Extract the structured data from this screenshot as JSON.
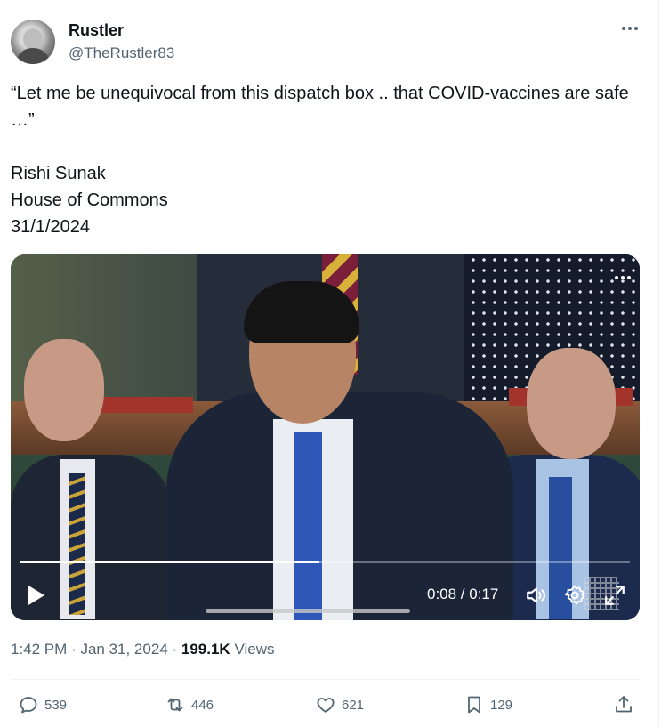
{
  "user": {
    "name": "Rustler",
    "handle": "@TheRustler83"
  },
  "tweet": {
    "lines": [
      "“Let me be unequivocal from this dispatch box .. that COVID-vaccines are safe …”",
      "Rishi Sunak",
      "House of Commons",
      "31/1/2024"
    ]
  },
  "video": {
    "time": "0:08 / 0:17",
    "progress": 0.49
  },
  "meta": {
    "time": "1:42 PM",
    "date": "Jan 31, 2024",
    "views_count": "199.1K",
    "views_label": "Views"
  },
  "actions": {
    "replies": "539",
    "reposts": "446",
    "likes": "621",
    "bookmarks": "129"
  },
  "icons": [
    "more-icon",
    "play-icon",
    "volume-icon",
    "settings-icon",
    "fullscreen-icon",
    "reply-icon",
    "repost-icon",
    "like-icon",
    "bookmark-icon",
    "share-icon"
  ]
}
